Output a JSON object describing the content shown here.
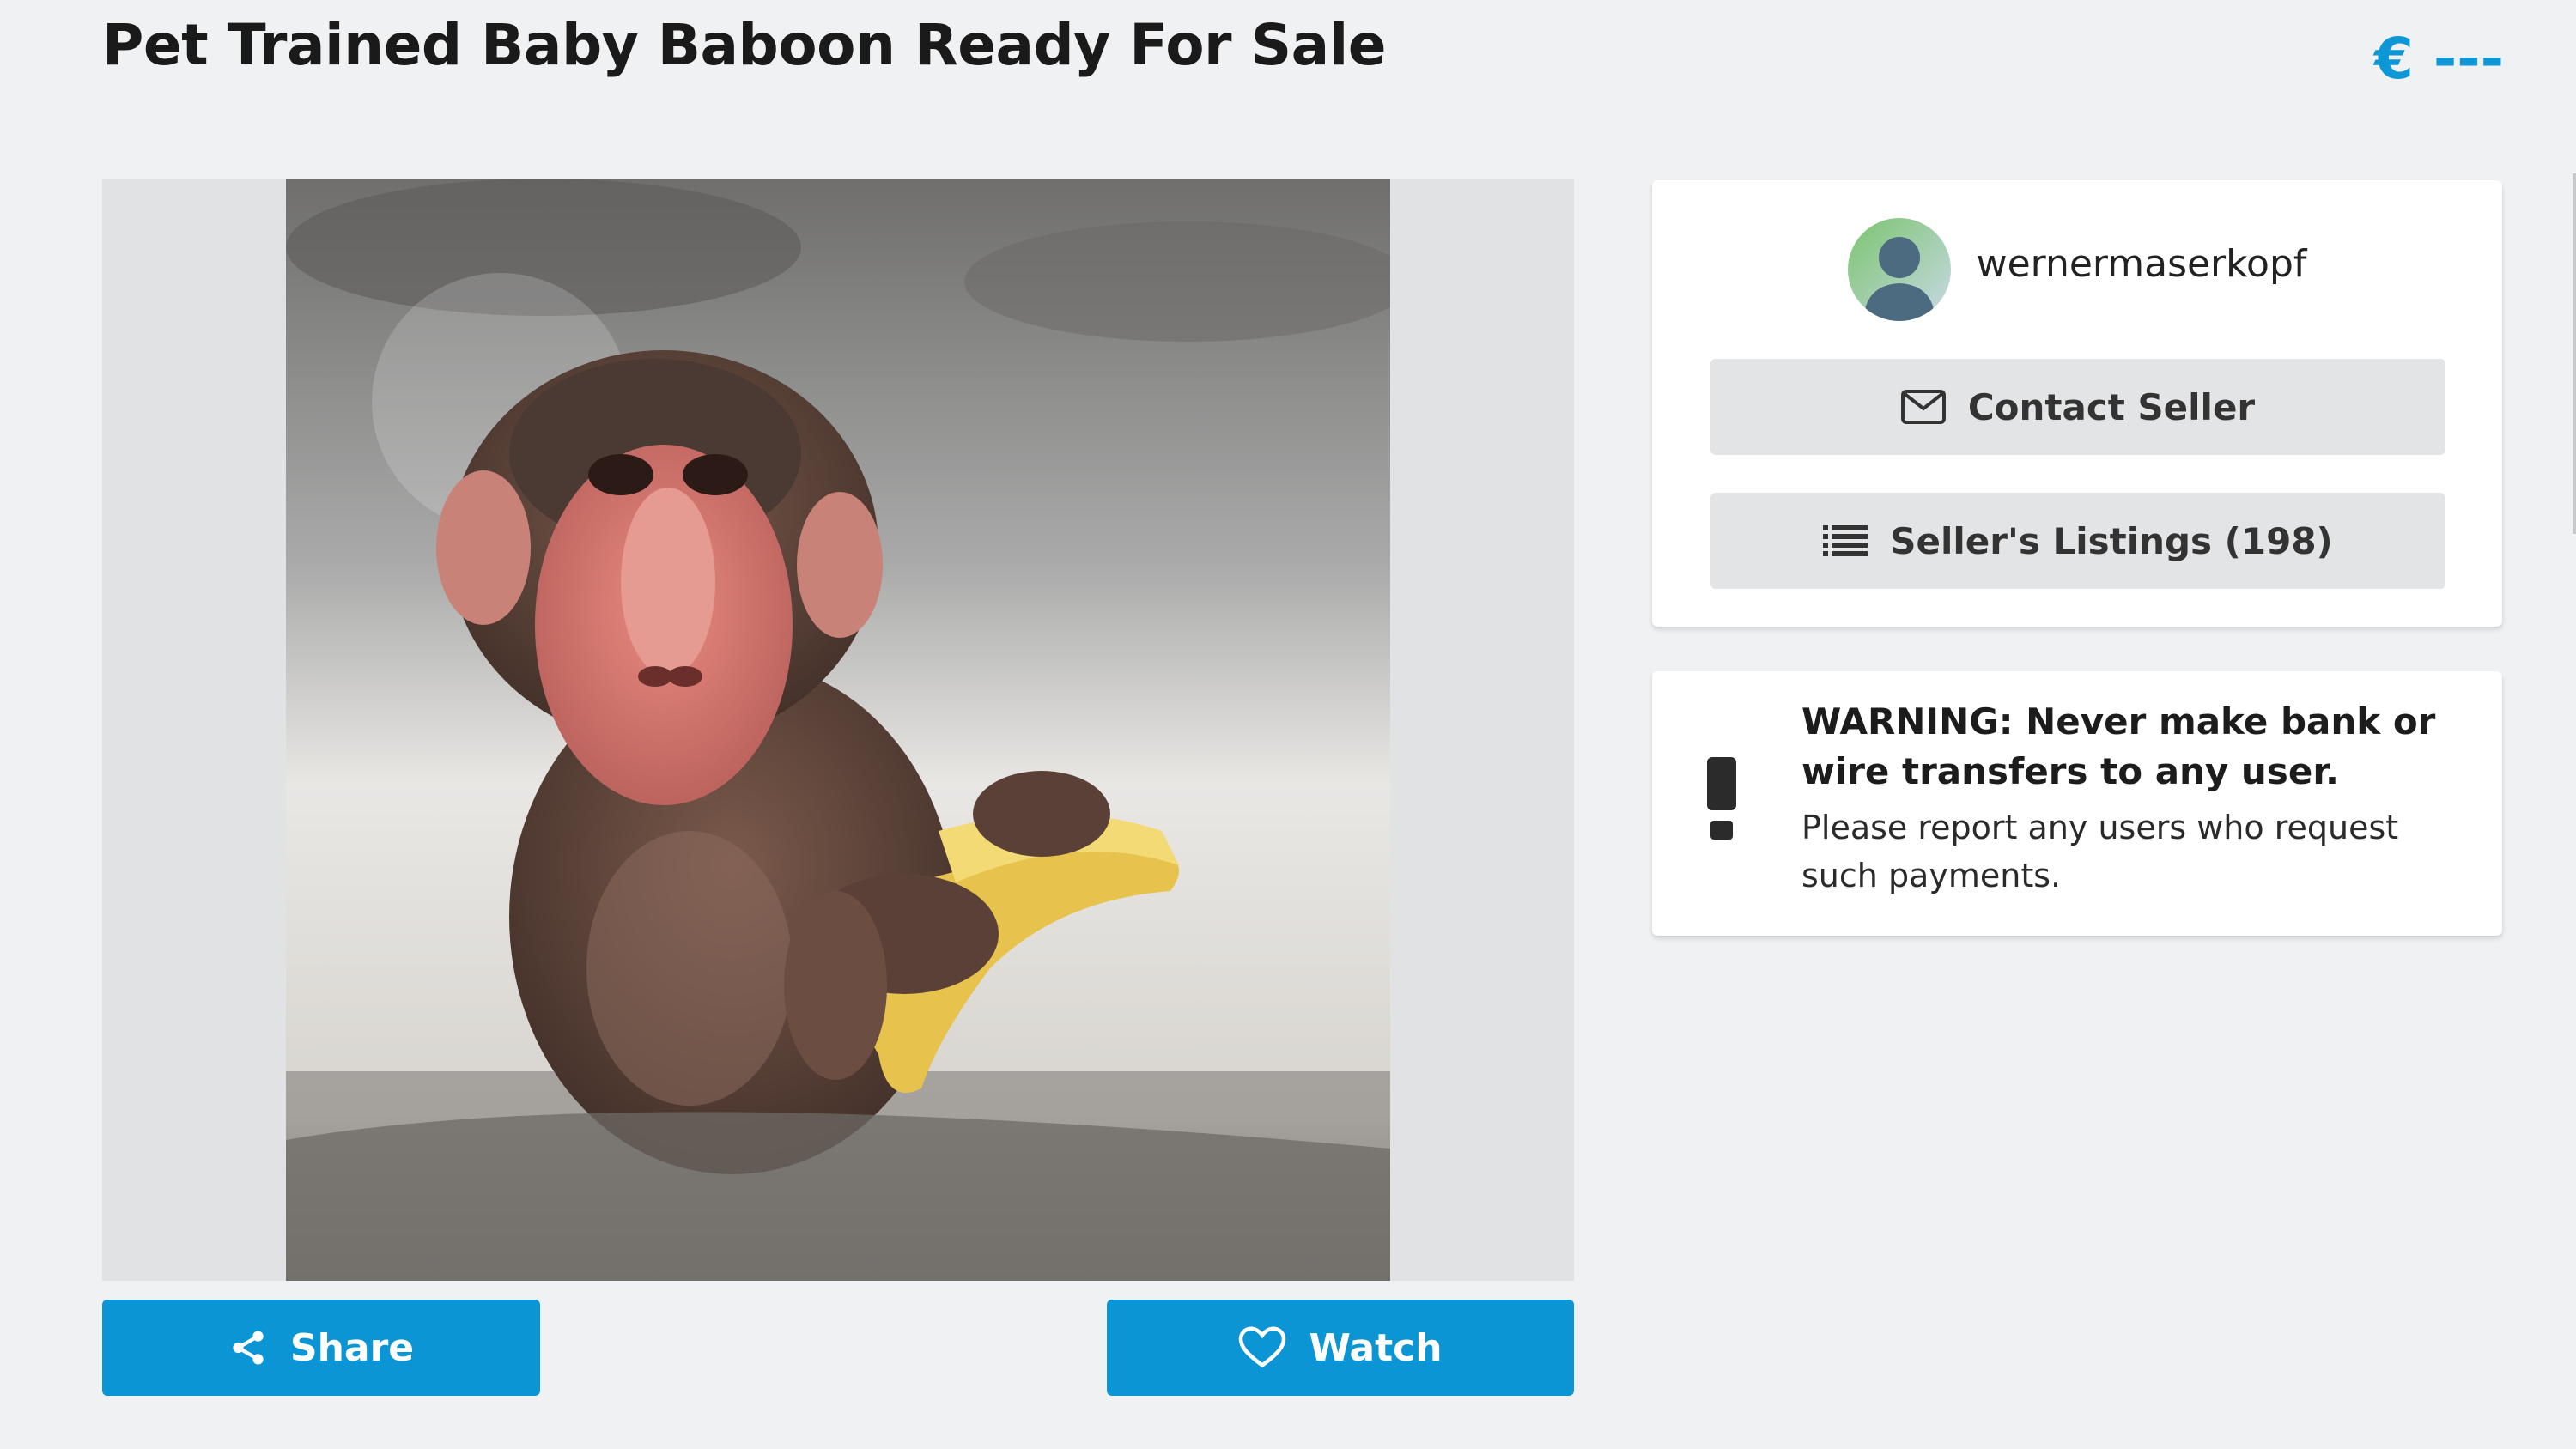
{
  "listing": {
    "title": "Pet Trained Baby Baboon Ready For Sale",
    "price": "€ ---"
  },
  "gallery": {
    "image_icon": "baboon-photo"
  },
  "actions": {
    "share_label": "Share",
    "share_icon": "share-icon",
    "watch_label": "Watch",
    "watch_icon": "heart-icon"
  },
  "seller": {
    "username": "wernermaserkopf",
    "avatar_icon": "user-avatar-icon",
    "contact_label": "Contact Seller",
    "contact_icon": "envelope-icon",
    "listings_label": "Seller's Listings (198)",
    "listings_icon": "list-icon"
  },
  "warning": {
    "icon": "exclamation-icon",
    "heading": "WARNING: Never make bank or wire transfers to any user.",
    "body": "Please report any users who request such payments."
  },
  "colors": {
    "accent": "#0c95d4",
    "price": "#0e97d6",
    "background": "#f0f1f3",
    "card": "#ffffff",
    "grey_button": "#e3e4e6"
  }
}
